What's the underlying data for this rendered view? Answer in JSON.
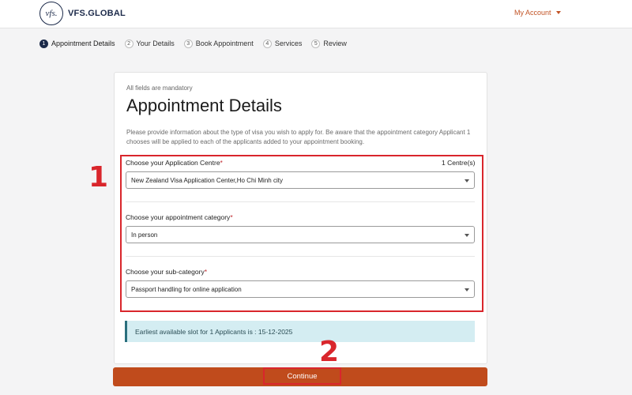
{
  "header": {
    "logo_text": "vfs.",
    "brand": "VFS.GLOBAL",
    "account_label": "My Account"
  },
  "steps": [
    {
      "num": "1",
      "label": "Appointment Details"
    },
    {
      "num": "2",
      "label": "Your Details"
    },
    {
      "num": "3",
      "label": "Book Appointment"
    },
    {
      "num": "4",
      "label": "Services"
    },
    {
      "num": "5",
      "label": "Review"
    }
  ],
  "form": {
    "mandatory_note": "All fields are mandatory",
    "title": "Appointment Details",
    "description": "Please provide information about the type of visa you wish to apply for. Be aware that the appointment category Applicant 1 chooses will be applied to each of the applicants added to your appointment booking.",
    "centre_label": "Choose your Application Centre",
    "centre_count": "1 Centre(s)",
    "centre_value": "New Zealand Visa Application Center,Ho Chi Minh city",
    "category_label": "Choose your appointment category",
    "category_value": "In person",
    "subcategory_label": "Choose your sub-category",
    "subcategory_value": "Passport handling for online application",
    "required_mark": "*",
    "slot_info": "Earliest available slot for 1 Applicants is : 15-12-2025",
    "continue_label": "Continue"
  },
  "annotations": {
    "one": "1",
    "two": "2",
    "color": "#d9262c"
  },
  "colors": {
    "accent": "#c04b1c",
    "brand": "#1c2a4a",
    "info_bg": "#d4edf2"
  }
}
